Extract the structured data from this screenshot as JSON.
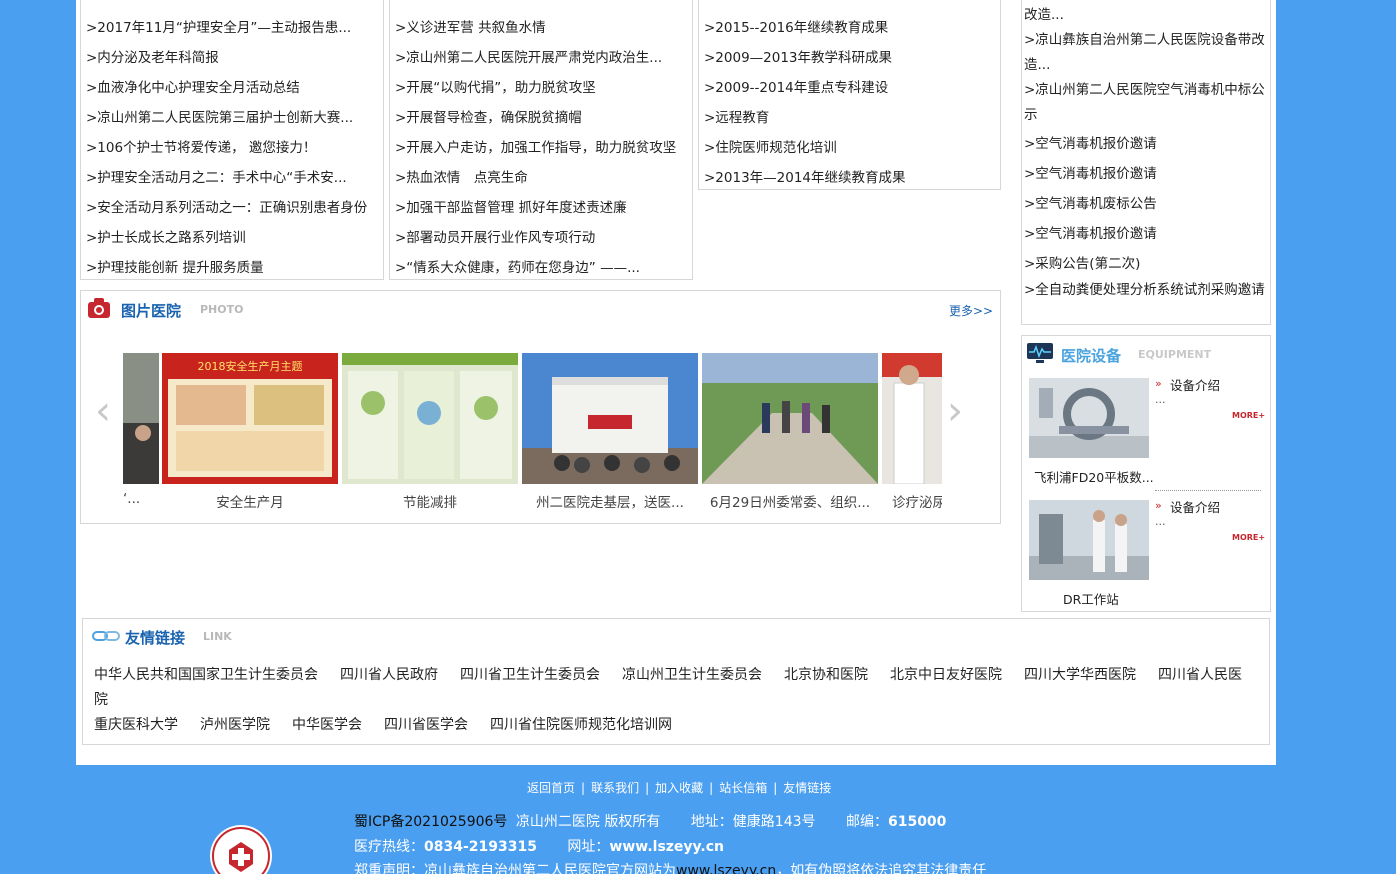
{
  "col1": {
    "items": [
      ">2017年11月“护理安全月”—主动报告患...",
      ">内分泌及老年科简报",
      ">血液净化中心护理安全月活动总结",
      ">凉山州第二人民医院第三届护士创新大赛...",
      ">106个护士节将爱传递， 邀您接力！",
      ">护理安全活动月之二：手术中心“手术安...",
      ">安全活动月系列活动之一：正确识别患者身份",
      ">护士长成长之路系列培训",
      ">护理技能创新 提升服务质量"
    ]
  },
  "col2": {
    "items": [
      ">义诊进军营 共叙鱼水情",
      ">凉山州第二人民医院开展严肃党内政治生...",
      ">开展“以购代捐”，助力脱贫攻坚",
      ">开展督导检查，确保脱贫摘帽",
      ">开展入户走访，加强工作指导，助力脱贫攻坚",
      ">热血浓情　点亮生命",
      ">加强干部监督管理 抓好年度述责述廉",
      ">部署动员开展行业作风专项行动",
      ">“情系大众健康，药师在您身边” ——..."
    ]
  },
  "col3": {
    "items": [
      ">2015--2016年继续教育成果",
      ">2009—2013年教学科研成果",
      ">2009--2014年重点专科建设",
      ">远程教育",
      ">住院医师规范化培训",
      ">2013年—2014年继续教育成果"
    ]
  },
  "notices": {
    "items": [
      "改造...",
      ">凉山彝族自治州第二人民医院设备带改造...",
      ">凉山州第二人民医院空气消毒机中标公示",
      ">空气消毒机报价邀请",
      ">空气消毒机报价邀请",
      ">空气消毒机废标公告",
      ">空气消毒机报价邀请",
      ">采购公告(第二次)",
      ">全自动粪便处理分析系统试剂采购邀请"
    ]
  },
  "photos": {
    "title": "图片医院",
    "subtitle": "PHOTO",
    "more": "更多>>",
    "prev": "‹",
    "next": "›",
    "captions": [
      "‘...",
      "安全生产月",
      "节能减排",
      "州二医院走基层，送医...",
      "6月29日州委常委、组织...",
      "诊疗泌尿"
    ]
  },
  "equipment": {
    "title": "医院设备",
    "subtitle": "EQUIPMENT",
    "items": [
      {
        "tag": "设备介绍",
        "ellipsis": "...",
        "more": "MORE+",
        "caption": "飞利浦FD20平板数..."
      },
      {
        "tag": "设备介绍",
        "ellipsis": "...",
        "more": "MORE+",
        "caption": "DR工作站"
      }
    ]
  },
  "links": {
    "title": "友情链接",
    "subtitle": "LINK",
    "row1": [
      "中华人民共和国国家卫生计生委员会",
      "四川省人民政府",
      "四川省卫生计生委员会",
      "凉山州卫生计生委员会",
      "北京协和医院",
      "北京中日友好医院",
      "四川大学华西医院",
      "四川省人民医"
    ],
    "row1_wrap": "院",
    "row2": [
      "重庆医科大学",
      "泸州医学院",
      "中华医学会",
      "四川省医学会",
      "四川省住院医师规范化培训网"
    ]
  },
  "footer": {
    "nav": [
      "返回首页",
      "联系我们",
      "加入收藏",
      "站长信箱",
      "友情链接"
    ],
    "icp": "蜀ICP备2021025906号",
    "copyright": "凉山州二医院 版权所有",
    "address_label": "地址：",
    "address": "健康路143号",
    "zip_label": "邮编：",
    "zip": "615000",
    "hotline_label": "医疗热线：",
    "hotline": "0834-2193315",
    "site_label": "网址：",
    "site": "www.lszeyy.cn",
    "notice_a": "郑重声明：凉山彝族自治州第二人民医院官方网站为",
    "notice_site": "www.lszeyy.cn",
    "notice_b": "，如有伪照将依法追究其法律责任"
  },
  "colors": {
    "page_bg": "#4b9ff0",
    "title_blue": "#1a63b0",
    "accent_red": "#c6262e"
  }
}
